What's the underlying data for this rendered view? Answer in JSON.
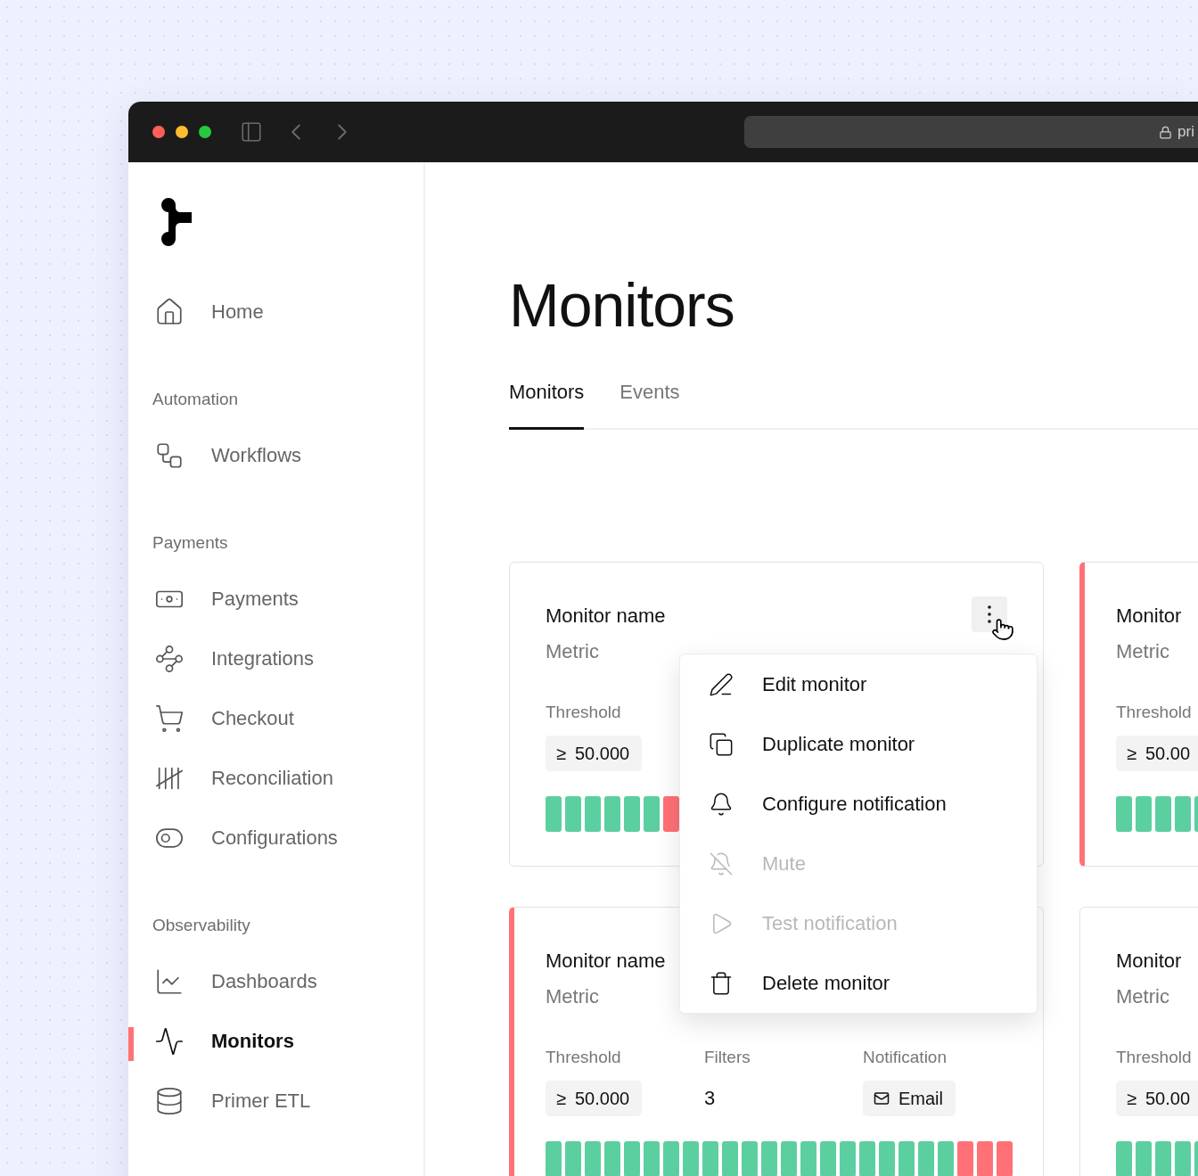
{
  "browser": {
    "address": "pri"
  },
  "sidebar": {
    "groups": [
      {
        "items": [
          {
            "label": "Home",
            "selected": false
          }
        ]
      },
      {
        "title": "Automation",
        "items": [
          {
            "label": "Workflows",
            "selected": false
          }
        ]
      },
      {
        "title": "Payments",
        "items": [
          {
            "label": "Payments",
            "selected": false
          },
          {
            "label": "Integrations",
            "selected": false
          },
          {
            "label": "Checkout",
            "selected": false
          },
          {
            "label": "Reconciliation",
            "selected": false
          },
          {
            "label": "Configurations",
            "selected": false
          }
        ]
      },
      {
        "title": "Observability",
        "items": [
          {
            "label": "Dashboards",
            "selected": false
          },
          {
            "label": "Monitors",
            "selected": true
          },
          {
            "label": "Primer ETL",
            "selected": false
          }
        ]
      }
    ]
  },
  "page": {
    "title": "Monitors"
  },
  "tabs": [
    {
      "label": "Monitors",
      "selected": true
    },
    {
      "label": "Events",
      "selected": false
    }
  ],
  "cards": [
    {
      "title": "Monitor name",
      "subtitle": "Metric",
      "alert": false,
      "menu_open": true,
      "fields": [
        {
          "kind": "threshold",
          "label": "Threshold",
          "sign": "≥",
          "value": "50.000"
        }
      ],
      "bars": [
        {
          "color": "#5ccfa1"
        },
        {
          "color": "#5ccfa1"
        },
        {
          "color": "#5ccfa1"
        },
        {
          "color": "#5ccfa1"
        },
        {
          "color": "#5ccfa1"
        },
        {
          "color": "#5ccfa1"
        },
        {
          "color": "#ff7177"
        }
      ]
    },
    {
      "title": "Monitor",
      "subtitle": "Metric",
      "alert": true,
      "menu_open": false,
      "fields": [
        {
          "kind": "threshold",
          "label": "Threshold",
          "sign": "≥",
          "value": "50.00"
        }
      ],
      "bars": [
        {
          "color": "#5ccfa1"
        },
        {
          "color": "#5ccfa1"
        },
        {
          "color": "#5ccfa1"
        },
        {
          "color": "#5ccfa1"
        },
        {
          "color": "#5ccfa1"
        }
      ]
    },
    {
      "title": "Monitor name",
      "subtitle": "Metric",
      "alert": true,
      "menu_open": false,
      "fields": [
        {
          "kind": "threshold",
          "label": "Threshold",
          "sign": "≥",
          "value": "50.000"
        },
        {
          "kind": "count",
          "label": "Filters",
          "value": "3"
        },
        {
          "kind": "notification",
          "label": "Notification",
          "value": "Email"
        }
      ],
      "bars": [
        {
          "color": "#5ccfa1"
        },
        {
          "color": "#5ccfa1"
        },
        {
          "color": "#5ccfa1"
        },
        {
          "color": "#5ccfa1"
        },
        {
          "color": "#5ccfa1"
        },
        {
          "color": "#5ccfa1"
        },
        {
          "color": "#5ccfa1"
        },
        {
          "color": "#5ccfa1"
        },
        {
          "color": "#5ccfa1"
        },
        {
          "color": "#5ccfa1"
        },
        {
          "color": "#5ccfa1"
        },
        {
          "color": "#5ccfa1"
        },
        {
          "color": "#5ccfa1"
        },
        {
          "color": "#5ccfa1"
        },
        {
          "color": "#5ccfa1"
        },
        {
          "color": "#5ccfa1"
        },
        {
          "color": "#5ccfa1"
        },
        {
          "color": "#5ccfa1"
        },
        {
          "color": "#5ccfa1"
        },
        {
          "color": "#5ccfa1"
        },
        {
          "color": "#5ccfa1"
        },
        {
          "color": "#ff7177"
        },
        {
          "color": "#ff7177"
        },
        {
          "color": "#ff7177"
        }
      ]
    },
    {
      "title": "Monitor",
      "subtitle": "Metric",
      "alert": false,
      "menu_open": false,
      "fields": [
        {
          "kind": "threshold",
          "label": "Threshold",
          "sign": "≥",
          "value": "50.00"
        }
      ],
      "bars": [
        {
          "color": "#5ccfa1"
        },
        {
          "color": "#5ccfa1"
        },
        {
          "color": "#5ccfa1"
        },
        {
          "color": "#5ccfa1"
        },
        {
          "color": "#5ccfa1"
        }
      ]
    }
  ],
  "menu": [
    {
      "label": "Edit monitor",
      "disabled": false
    },
    {
      "label": "Duplicate monitor",
      "disabled": false
    },
    {
      "label": "Configure notification",
      "disabled": false
    },
    {
      "label": "Mute",
      "disabled": true
    },
    {
      "label": "Test notification",
      "disabled": true
    },
    {
      "label": "Delete monitor",
      "disabled": false
    }
  ]
}
